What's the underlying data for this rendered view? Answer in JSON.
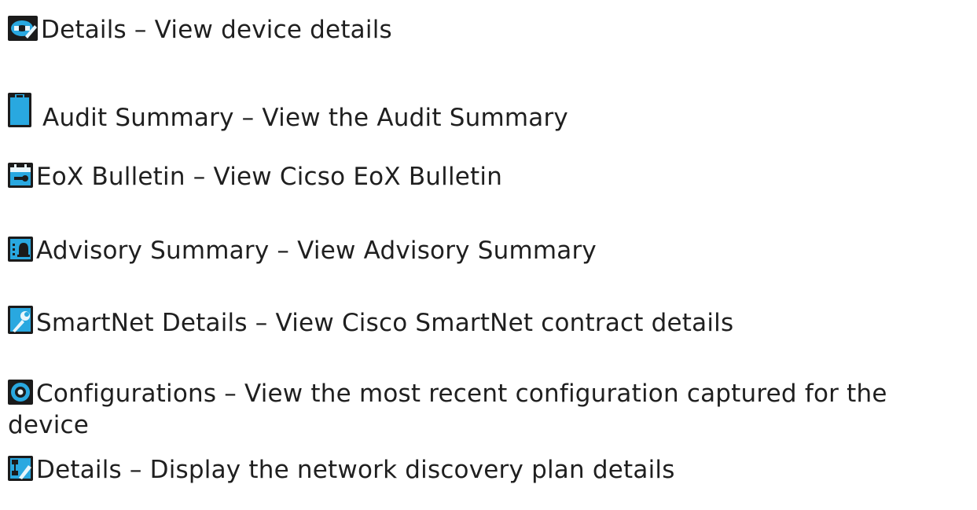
{
  "items": [
    {
      "icon": "device-details-icon",
      "text": "Details – View device details"
    },
    {
      "icon": "clipboard-icon",
      "text": " Audit Summary – View the Audit Summary"
    },
    {
      "icon": "calendar-wrench-icon",
      "text": "EoX Bulletin – View Cicso EoX Bulletin"
    },
    {
      "icon": "bell-list-icon",
      "text": "Advisory Summary – View Advisory Summary"
    },
    {
      "icon": "wrench-icon",
      "text": "SmartNet Details – View Cisco SmartNet contract details"
    },
    {
      "icon": "eye-icon",
      "text": "Configurations – View the most recent configuration captured for the device"
    },
    {
      "icon": "network-plan-edit-icon",
      "text": "Details – Display the network discovery plan details"
    }
  ],
  "colors": {
    "text": "#1f1f1f",
    "icon_bg": "#1b1b1b",
    "icon_blue": "#29a8e0"
  }
}
